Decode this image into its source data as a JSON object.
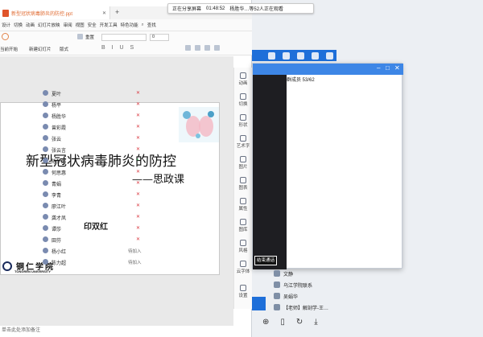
{
  "share_bar": {
    "status": "正在分享屏幕",
    "time": "01:48:52",
    "viewers": "杨胜华…等52人正在观看"
  },
  "wps": {
    "tab_title": "新型冠状病毒肺炎的防控.ppt",
    "menu": [
      "设计",
      "切换",
      "动画",
      "幻灯片放映",
      "审阅",
      "视图",
      "安全",
      "开发工具",
      "特色功能",
      "查找"
    ],
    "ribbon": {
      "reset": "重置",
      "start": "当前开始",
      "new_slide": "新建幻灯片",
      "layout": "版式",
      "font_size": "0"
    },
    "notes_placeholder": "单击此处添加备注"
  },
  "slide": {
    "title": "新型冠状病毒肺炎的防控",
    "subtitle": "——思政课",
    "author": "印双红",
    "logo_cn": "铜仁学院",
    "logo_en": "TONGREN UNIVERSITY"
  },
  "side_tools": [
    "动画",
    "切换",
    "形状",
    "艺术字",
    "图片",
    "图表",
    "属性",
    "图库",
    "风格",
    "云字体",
    "设置"
  ],
  "panel": {
    "members_label": "群成员 53/62",
    "end_call": "结束通话",
    "members": [
      {
        "name": "夏叶",
        "status": ""
      },
      {
        "name": "杨平",
        "status": ""
      },
      {
        "name": "杨胜华",
        "status": ""
      },
      {
        "name": "曾彩霞",
        "status": ""
      },
      {
        "name": "张云",
        "status": ""
      },
      {
        "name": "张云言",
        "status": ""
      },
      {
        "name": "陈梦娟",
        "status": ""
      },
      {
        "name": "何思惠",
        "status": ""
      },
      {
        "name": "青娟",
        "status": ""
      },
      {
        "name": "李青",
        "status": ""
      },
      {
        "name": "廖江叶",
        "status": ""
      },
      {
        "name": "龚才凤",
        "status": ""
      },
      {
        "name": "谭莎",
        "status": ""
      },
      {
        "name": "田芬",
        "status": ""
      },
      {
        "name": "杨小红",
        "status": "待加入"
      },
      {
        "name": "陈力超",
        "status": "待加入"
      }
    ]
  },
  "chats": [
    {
      "name": "文静"
    },
    {
      "name": "乌江学院联系"
    },
    {
      "name": "吴娟华"
    },
    {
      "name": "【老师】解剖学-王…"
    }
  ]
}
